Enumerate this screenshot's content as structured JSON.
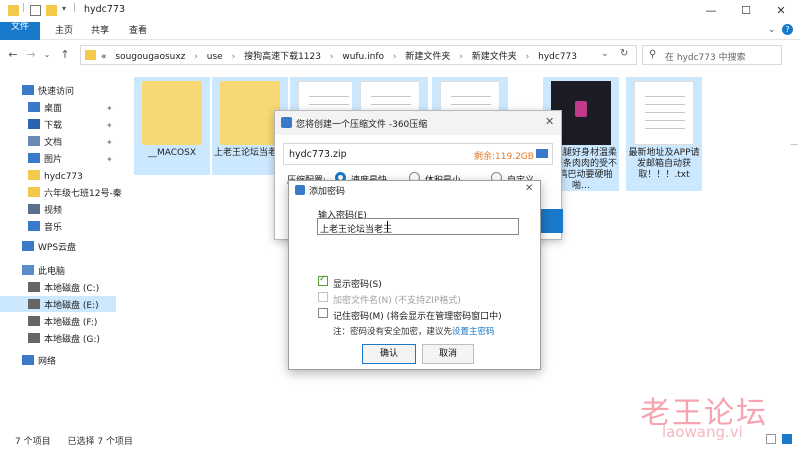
{
  "window": {
    "title": "hydc773",
    "controls": [
      "—",
      "☐",
      "✕"
    ]
  },
  "ribbon": {
    "tabs": [
      "文件",
      "主页",
      "共享",
      "查看"
    ]
  },
  "address": {
    "crumbs": [
      "«",
      "sougougaosuxz",
      "›",
      "use",
      "›",
      "搜狗高速下载1123",
      "›",
      "wufu.info",
      "›",
      "新建文件夹",
      "›",
      "新建文件夹",
      "›",
      "hydc773"
    ],
    "search_placeholder": "在 hydc773 中搜索"
  },
  "sidebar": {
    "items": [
      {
        "label": "快速访问",
        "icon": "star-icon"
      },
      {
        "label": "桌面",
        "icon": "desktop-icon",
        "pinned": true
      },
      {
        "label": "下载",
        "icon": "download-icon",
        "pinned": true
      },
      {
        "label": "文档",
        "icon": "document-icon",
        "pinned": true
      },
      {
        "label": "图片",
        "icon": "picture-icon",
        "pinned": true
      },
      {
        "label": "hydc773",
        "icon": "folder-icon"
      },
      {
        "label": "六年级七班12号-秦",
        "icon": "folder-icon"
      },
      {
        "label": "视频",
        "icon": "video-icon"
      },
      {
        "label": "音乐",
        "icon": "music-icon"
      },
      {
        "label": "WPS云盘",
        "icon": "cloud-icon"
      },
      {
        "label": "此电脑",
        "icon": "computer-icon"
      },
      {
        "label": "本地磁盘 (C:)",
        "icon": "drive-icon"
      },
      {
        "label": "本地磁盘 (E:)",
        "icon": "drive-icon"
      },
      {
        "label": "本地磁盘 (F:)",
        "icon": "drive-icon"
      },
      {
        "label": "本地磁盘 (G:)",
        "icon": "drive-icon"
      },
      {
        "label": "网络",
        "icon": "network-icon"
      }
    ]
  },
  "files": [
    {
      "name": "__MACOSX",
      "type": "folder"
    },
    {
      "name": "上老王论坛当老王",
      "type": "folder"
    },
    {
      "name": "",
      "type": "doc"
    },
    {
      "name": "",
      "type": "doc"
    },
    {
      "name": "",
      "type": "doc"
    },
    {
      "name": "…乐腿好身材温柔手面条肉肉的受不了鸡巴动要硬啪啪…",
      "type": "video"
    },
    {
      "name": "最新地址及APP请发邮箱自动获取！！！.txt",
      "type": "doc"
    }
  ],
  "status": {
    "count": "7 个项目",
    "selected": "已选择 7 个项目"
  },
  "zip_dialog": {
    "title": "您将创建一个压缩文件 -360压缩",
    "filename": "hydc773.zip",
    "free_space": "剩余:119.2GB",
    "mode_label": "压缩配置:",
    "options": [
      "速度最快",
      "体积最小",
      "自定义"
    ]
  },
  "password_dialog": {
    "title": "添加密码",
    "input_label": "输入密码(E)",
    "password_value": "上老王论坛当老王",
    "show_password": "显示密码(S)",
    "encrypt_names": "加密文件名(N) (不支持ZIP格式)",
    "remember": "记住密码(M) (将会显示在管理密码窗口中)",
    "note": "注：密码没有安全加密，建议先",
    "note_link": "设置主密码",
    "ok": "确认",
    "cancel": "取消"
  },
  "watermark": {
    "text": "老王论坛",
    "sub": "laowang.vi"
  },
  "colors": {
    "accent": "#1979ca",
    "folder": "#f8d775",
    "selection": "#cce8ff"
  }
}
